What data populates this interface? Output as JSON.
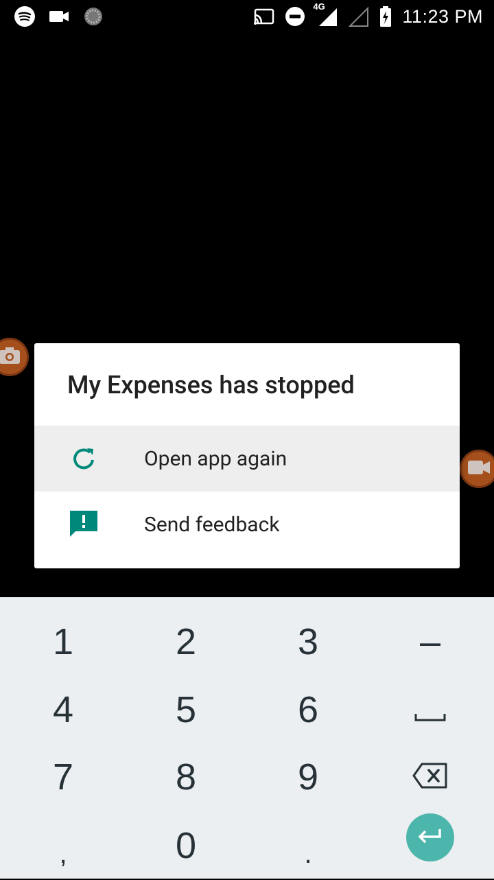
{
  "status_bar": {
    "time": "11:23 PM",
    "network": "4G",
    "left_icons": [
      "spotify-icon",
      "video-camera-icon",
      "loading-spinner-icon"
    ],
    "right_icons": [
      "cast-icon",
      "do-not-disturb-icon",
      "signal-4g-icon",
      "signal-empty-icon",
      "battery-charging-icon"
    ]
  },
  "dialog": {
    "title": "My Expenses has stopped",
    "items": [
      {
        "label": "Open app again",
        "icon": "refresh-icon"
      },
      {
        "label": "Send feedback",
        "icon": "feedback-icon"
      }
    ],
    "accent_color": "#00897b"
  },
  "keyboard": {
    "rows": [
      [
        "1",
        "2",
        "3",
        "–"
      ],
      [
        "4",
        "5",
        "6",
        "space"
      ],
      [
        "7",
        "8",
        "9",
        "backspace"
      ],
      [
        ",",
        "0",
        ".",
        "enter"
      ]
    ],
    "enter_color": "#4db6ac"
  },
  "overlay_buttons": {
    "left": "camera-icon",
    "right": "video-camera-icon"
  }
}
